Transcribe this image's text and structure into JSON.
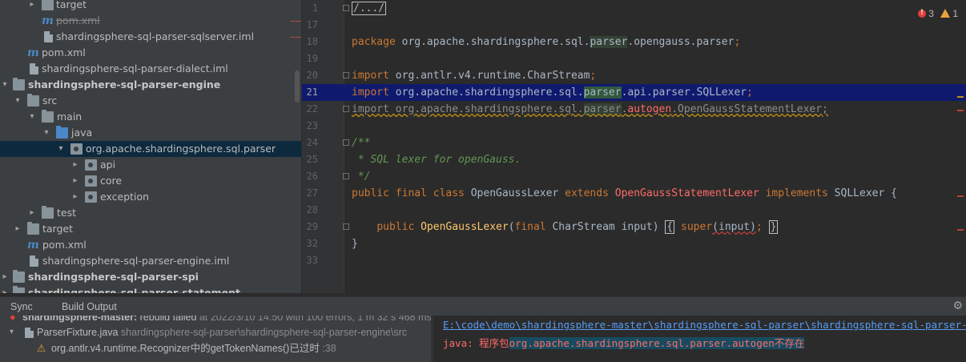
{
  "tree": {
    "items": [
      {
        "label": "target",
        "icon": "folder-icon"
      },
      {
        "label": "pom.xml",
        "icon": "maven-icon"
      },
      {
        "label": "shardingsphere-sql-parser-sqlserver.iml",
        "icon": "file-icon"
      },
      {
        "label": "pom.xml",
        "icon": "maven-icon"
      },
      {
        "label": "shardingsphere-sql-parser-dialect.iml",
        "icon": "file-icon"
      },
      {
        "label": "shardingsphere-sql-parser-engine",
        "icon": "module-folder-icon"
      },
      {
        "label": "src",
        "icon": "folder-icon"
      },
      {
        "label": "main",
        "icon": "folder-icon"
      },
      {
        "label": "java",
        "icon": "source-folder-icon"
      },
      {
        "label": "org.apache.shardingsphere.sql.parser",
        "icon": "package-icon"
      },
      {
        "label": "api",
        "icon": "package-icon"
      },
      {
        "label": "core",
        "icon": "package-icon"
      },
      {
        "label": "exception",
        "icon": "package-icon"
      },
      {
        "label": "test",
        "icon": "folder-icon"
      },
      {
        "label": "target",
        "icon": "folder-icon"
      },
      {
        "label": "pom.xml",
        "icon": "maven-icon"
      },
      {
        "label": "shardingsphere-sql-parser-engine.iml",
        "icon": "file-icon"
      },
      {
        "label": "shardingsphere-sql-parser-spi",
        "icon": "module-folder-icon"
      },
      {
        "label": "shardingsphere-sql-parser-statement",
        "icon": "module-folder-icon"
      }
    ]
  },
  "editor": {
    "inspections": {
      "errors": "3",
      "warnings": "1"
    },
    "lines": [
      {
        "num": "1"
      },
      {
        "num": "17"
      },
      {
        "num": "18"
      },
      {
        "num": "19"
      },
      {
        "num": "20"
      },
      {
        "num": "21"
      },
      {
        "num": "22"
      },
      {
        "num": "23"
      },
      {
        "num": "24"
      },
      {
        "num": "25"
      },
      {
        "num": "26"
      },
      {
        "num": "27"
      },
      {
        "num": "28"
      },
      {
        "num": "29"
      },
      {
        "num": "32"
      },
      {
        "num": "33"
      }
    ],
    "code": {
      "l1": "/.../",
      "l18_kw": "package",
      "l18_a": " org.apache.shardingsphere.sql.",
      "l18_b": "parser",
      "l18_c": ".opengauss.parser",
      "l18_d": ";",
      "l20_kw": "import",
      "l20_a": " org.antlr.v4.runtime.CharStream",
      "l20_d": ";",
      "l21_kw": "import",
      "l21_a": " org.apache.shardingsphere.sql.",
      "l21_b": "parser",
      "l21_c": ".api.parser.SQLLexer",
      "l21_d": ";",
      "l22_kw": "import",
      "l22_a": " org.apache.shardingsphere.sql.",
      "l22_b": "parser",
      "l22_c": ".",
      "l22_e": "autogen",
      "l22_f": ".OpenGaussStatementLexer",
      "l22_d": ";",
      "l24": "/**",
      "l25": " * SQL lexer for openGauss.",
      "l26": " */",
      "l27_kw1": "public final class",
      "l27_a": " OpenGaussLexer ",
      "l27_kw2": "extends",
      "l27_b": " OpenGaussStatementLexer",
      "l27_kw3": " implements",
      "l27_c": " SQLLexer {",
      "l29_kw": "public",
      "l29_fn": " OpenGaussLexer",
      "l29_a": "(",
      "l29_kw2": "final",
      "l29_b": " CharStream input)",
      "l29_c": "{",
      "l29_kw3": " super",
      "l29_d": "(input)",
      "l29_e": ";",
      "l29_f": "}",
      "l32": "}"
    }
  },
  "bottom": {
    "tabs": [
      {
        "label": "Sync"
      },
      {
        "label": "Build Output"
      }
    ],
    "build": {
      "row0_title": "shardingsphere-master:",
      "row0_status": " rebuild failed",
      "row0_meta": " at 2022/3/10 14:50 with 100 errors, 1 m 32 s 468 ms",
      "row1_file": "ParserFixture.java",
      "row1_path": " shardingsphere-sql-parser\\shardingsphere-sql-parser-engine\\src",
      "row2_msg": "org.antlr.v4.runtime.Recognizer中的getTokenNames()已过时",
      "row2_line": " :38"
    },
    "console": {
      "path": "E:\\code\\demo\\shardingsphere-master\\shardingsphere-sql-parser\\shardingsphere-sql-parser-engine",
      "err_prefix": "java: 程序包",
      "err_pkg": "org.apache.shardingsphere.sql.parser.autogen",
      "err_suffix": "不存在"
    }
  }
}
